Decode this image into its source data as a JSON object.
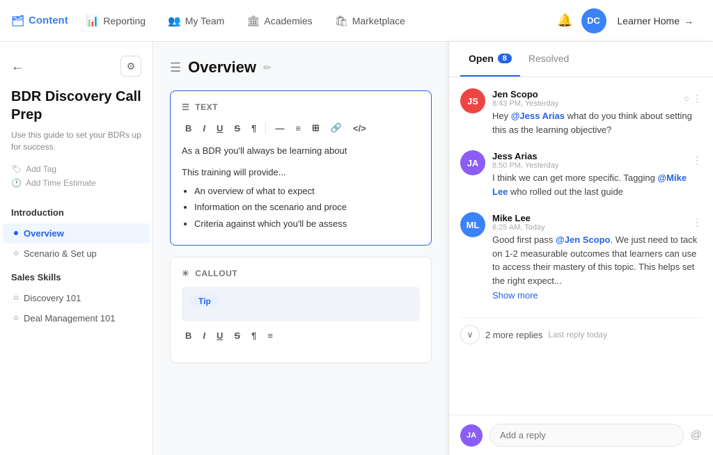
{
  "nav": {
    "logo_label": "Content",
    "logo_icon": "🗂",
    "items": [
      {
        "id": "reporting",
        "icon": "📊",
        "label": "Reporting"
      },
      {
        "id": "my-team",
        "icon": "👥",
        "label": "My Team"
      },
      {
        "id": "academies",
        "icon": "🏛",
        "label": "Academies"
      },
      {
        "id": "marketplace",
        "icon": "🛍",
        "label": "Marketplace"
      }
    ],
    "bell_icon": "🔔",
    "avatar_initials": "DC",
    "learner_home": "Learner Home",
    "learner_home_arrow": "→"
  },
  "sidebar": {
    "back_icon": "←",
    "gear_icon": "⚙",
    "title": "BDR Discovery Call Prep",
    "description": "Use this guide to set your BDRs up for success.",
    "add_tag": "Add Tag",
    "add_time_estimate": "Add Time Estimate",
    "tag_icon": "🏷",
    "clock_icon": "🕐",
    "sections": [
      {
        "title": "Introduction",
        "items": [
          {
            "label": "Overview",
            "active": true
          },
          {
            "label": "Scenario & Set up",
            "active": false
          }
        ]
      },
      {
        "title": "Sales Skills",
        "items": [
          {
            "label": "Discovery 101",
            "active": false
          },
          {
            "label": "Deal Management 101",
            "active": false
          }
        ]
      }
    ]
  },
  "content": {
    "header_icon": "☰",
    "title": "Overview",
    "edit_icon": "✏",
    "text_block": {
      "type_label": "TEXT",
      "body": "As a BDR you'll always be learning about",
      "subtext": "This training will provide...",
      "bullets": [
        "An overview of what to expect",
        "Information on the scenario and proce",
        "Criteria against which you'll be assess"
      ]
    },
    "callout_block": {
      "type_label": "CALLOUT",
      "tip_label": "Tip"
    }
  },
  "comments": {
    "tabs": [
      {
        "id": "open",
        "label": "Open",
        "badge": "8",
        "active": true
      },
      {
        "id": "resolved",
        "label": "Resolved",
        "active": false
      }
    ],
    "threads": [
      {
        "id": "jen-scopo",
        "avatar_initials": "JS",
        "avatar_class": "avatar-red",
        "name": "Jen Scopo",
        "time": "8:43 PM, Yesterday",
        "text_before": "Hey ",
        "mention1": "@Jess Arias",
        "text_after": " what do you think about setting this as the learning objective?",
        "has_resolve": true,
        "has_more": true
      },
      {
        "id": "jess-arias",
        "avatar_initials": "JA",
        "avatar_class": "avatar-purple",
        "name": "Jess Arias",
        "time": "8:50 PM, Yesterday",
        "text_before": "I think we can get more specific. Tagging ",
        "mention1": "@Mike Lee",
        "text_after": " who rolled out the last guide",
        "has_resolve": false,
        "has_more": true
      },
      {
        "id": "mike-lee",
        "avatar_initials": "ML",
        "avatar_class": "avatar-blue",
        "name": "Mike Lee",
        "time": "6:25 AM, Today",
        "text_before": "Good first pass ",
        "mention1": "@Jen Scopo",
        "text_after": ". We just need to tack on 1-2 measurable outcomes that learners can use to access their mastery of this topic. This helps set the right expect...",
        "has_resolve": false,
        "has_more": true,
        "show_more": true
      }
    ],
    "more_replies_count": "2 more replies",
    "more_replies_time": "Last reply today",
    "reply_placeholder": "Add a reply",
    "reply_avatar_initials": "JA",
    "show_more_label": "Show more"
  }
}
